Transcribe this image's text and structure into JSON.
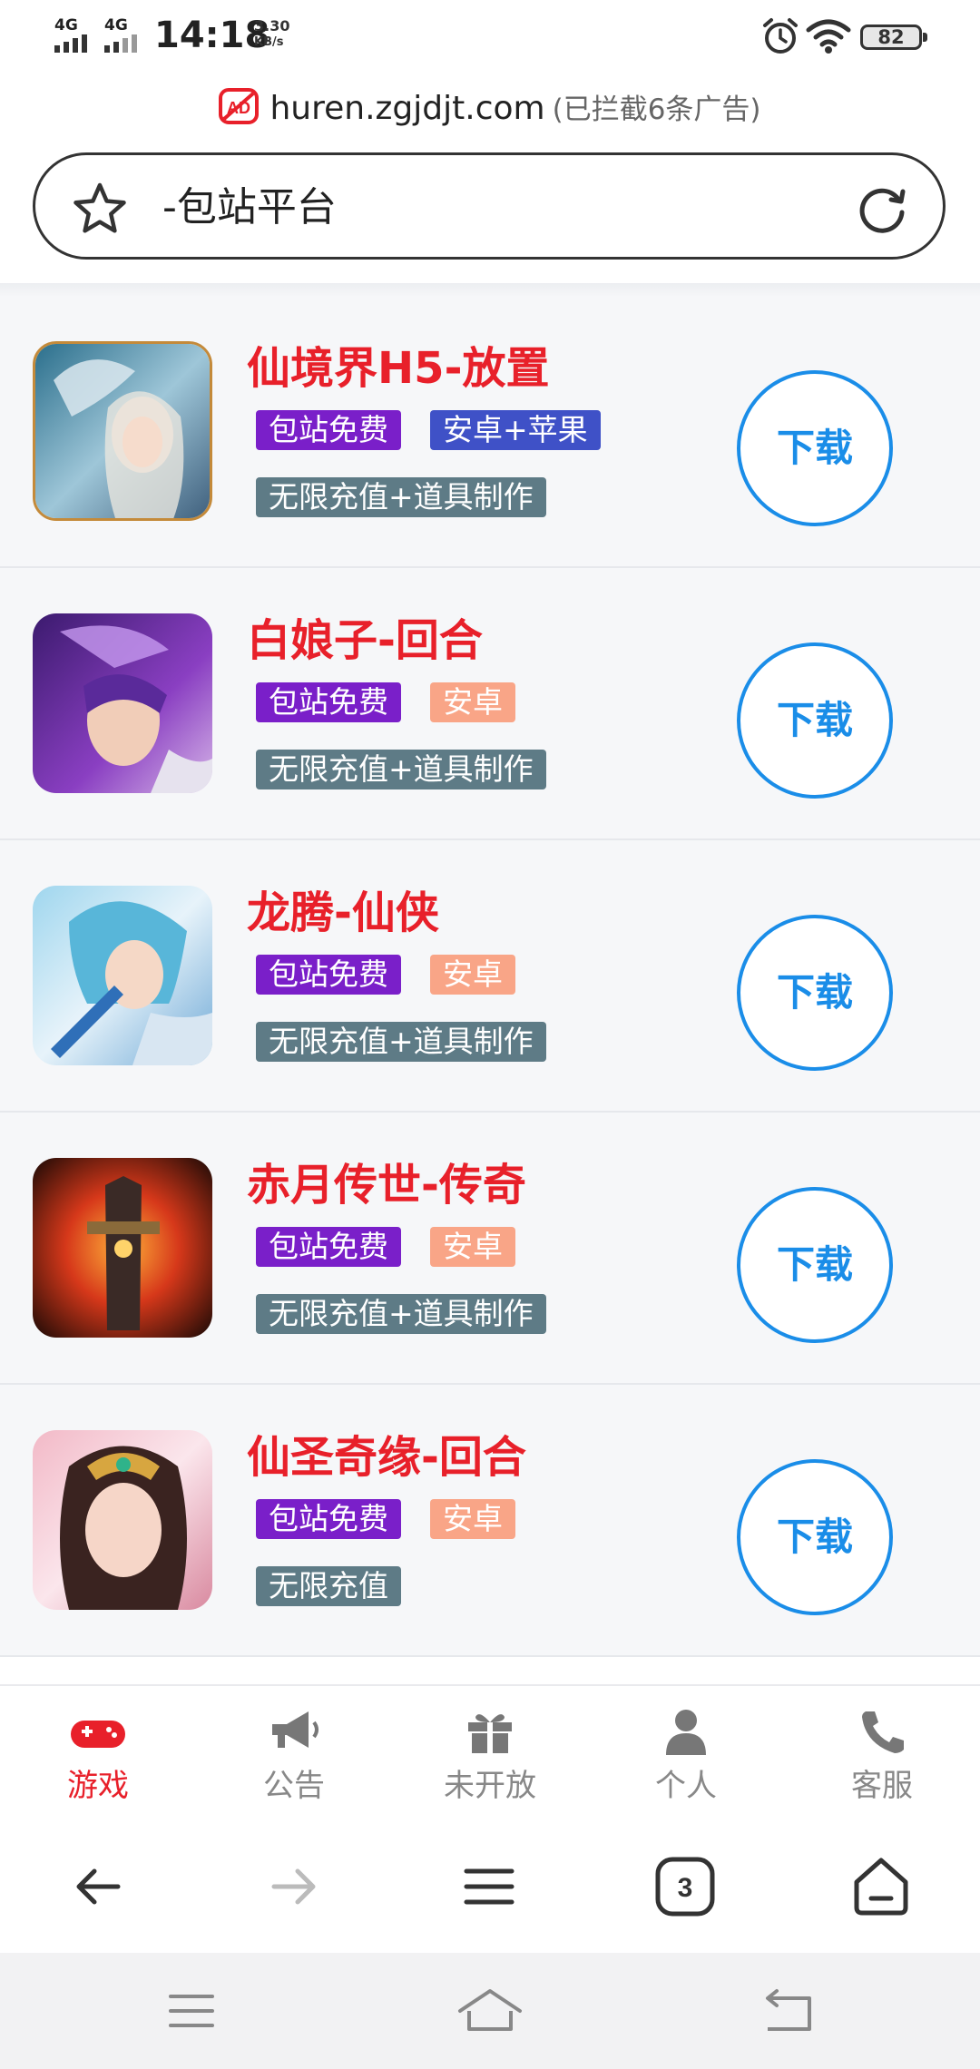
{
  "status_bar": {
    "net1": "4G",
    "net2": "4G",
    "time": "14:18",
    "speed_value": "3.30",
    "speed_unit": "KB/s",
    "battery": "82"
  },
  "url_bar": {
    "ad_icon_text": "AD",
    "url": "huren.zgjdjt.com",
    "blocked": "(已拦截6条广告)"
  },
  "search": {
    "text": "-包站平台"
  },
  "games": [
    {
      "title": "仙境界H5-放置",
      "tag_free": "包站免费",
      "tag_platform": "安卓+苹果",
      "platform_color": "#3f51c7",
      "tag_feature": "无限充值+道具制作",
      "download": "下载"
    },
    {
      "title": "白娘子-回合",
      "tag_free": "包站免费",
      "tag_platform": "安卓",
      "platform_color": "#f9a587",
      "tag_feature": "无限充值+道具制作",
      "download": "下载"
    },
    {
      "title": "龙腾-仙侠",
      "tag_free": "包站免费",
      "tag_platform": "安卓",
      "platform_color": "#f9a587",
      "tag_feature": "无限充值+道具制作",
      "download": "下载"
    },
    {
      "title": "赤月传世-传奇",
      "tag_free": "包站免费",
      "tag_platform": "安卓",
      "platform_color": "#f9a587",
      "tag_feature": "无限充值+道具制作",
      "download": "下载"
    },
    {
      "title": "仙圣奇缘-回合",
      "tag_free": "包站免费",
      "tag_platform": "安卓",
      "platform_color": "#f9a587",
      "tag_feature": "无限充值",
      "download": "下载"
    }
  ],
  "tab_bar": {
    "items": [
      {
        "label": "游戏",
        "icon": "gamepad-icon",
        "active": true
      },
      {
        "label": "公告",
        "icon": "megaphone-icon",
        "active": false
      },
      {
        "label": "未开放",
        "icon": "gift-icon",
        "active": false
      },
      {
        "label": "个人",
        "icon": "user-icon",
        "active": false
      },
      {
        "label": "客服",
        "icon": "phone-icon",
        "active": false
      }
    ]
  },
  "browser_nav": {
    "tab_count": "3"
  },
  "colors": {
    "accent_red": "#e8202a",
    "download_blue": "#1a8de8",
    "tag_purple": "#7a1fc9",
    "tag_gray": "#5e7b86"
  }
}
